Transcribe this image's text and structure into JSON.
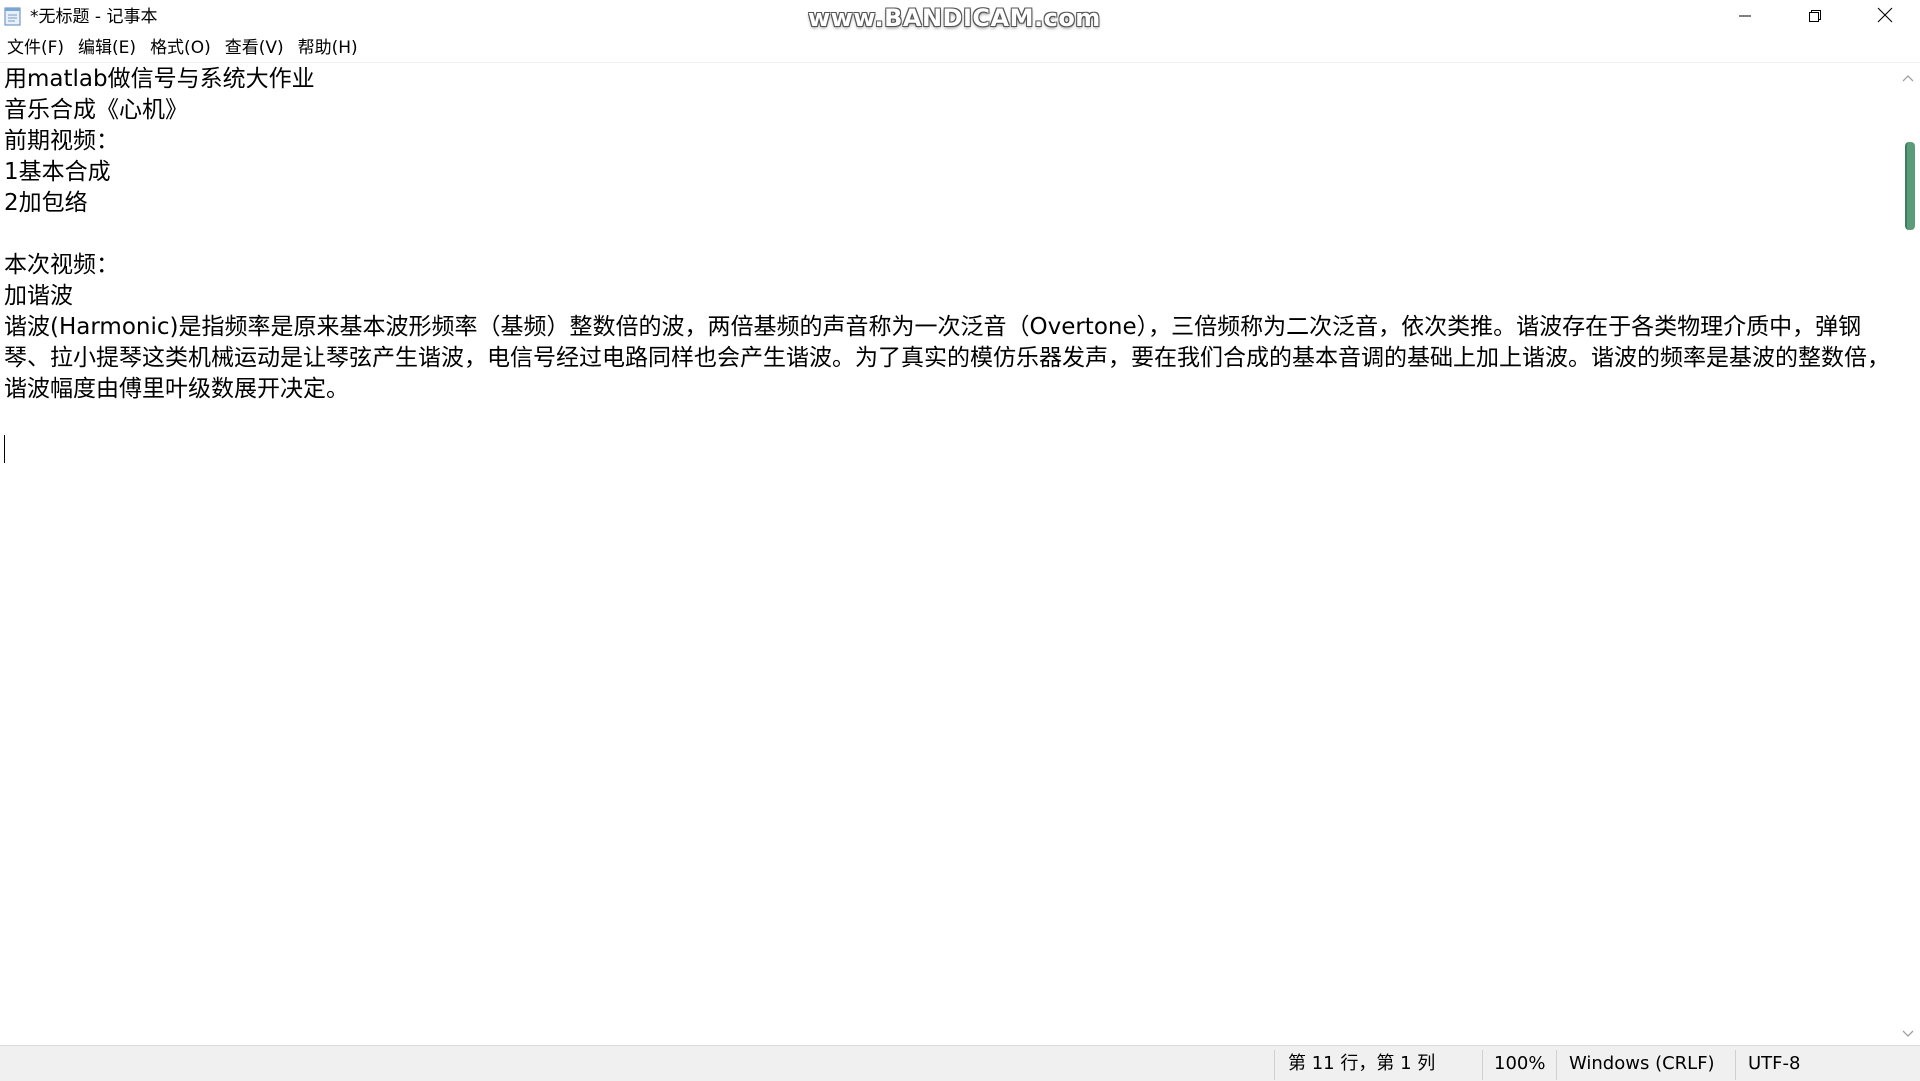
{
  "window": {
    "title": "*无标题 - 记事本",
    "watermark": "www.BANDICAM.com"
  },
  "menu": {
    "items": [
      {
        "label": "文件(F)"
      },
      {
        "label": "编辑(E)"
      },
      {
        "label": "格式(O)"
      },
      {
        "label": "查看(V)"
      },
      {
        "label": "帮助(H)"
      }
    ]
  },
  "editor": {
    "lines": [
      "用matlab做信号与系统大作业",
      "音乐合成《心机》",
      "前期视频：",
      "1基本合成",
      "2加包络",
      "",
      "本次视频：",
      "加谐波",
      "谐波(Harmonic)是指频率是原来基本波形频率（基频）整数倍的波，两倍基频的声音称为一次泛音（Overtone），三倍频称为二次泛音，依次类推。谐波存在于各类物理介质中，弹钢琴、拉小提琴这类机械运动是让琴弦产生谐波，电信号经过电路同样也会产生谐波。为了真实的模仿乐器发声，要在我们合成的基本音调的基础上加上谐波。谐波的频率是基波的整数倍，谐波幅度由傅里叶级数展开决定。",
      "",
      ""
    ]
  },
  "statusbar": {
    "position": "第 11 行，第 1 列",
    "zoom": "100%",
    "line_ending": "Windows (CRLF)",
    "encoding": "UTF-8"
  },
  "icons": {
    "app": "notepad-icon",
    "minimize": "minimize-icon",
    "maximize": "restore-icon",
    "close": "close-icon",
    "scroll_up": "chevron-up-icon",
    "scroll_down": "chevron-down-icon"
  },
  "colors": {
    "scroll_thumb": "#5a9c7a",
    "statusbar_bg": "#f0f0f0"
  }
}
